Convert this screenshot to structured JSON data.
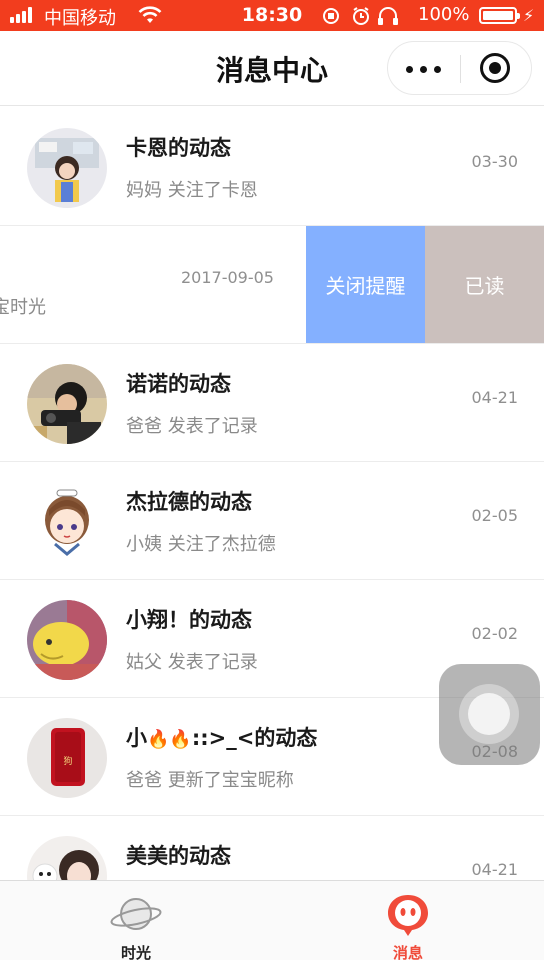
{
  "status_bar": {
    "carrier": "中国移动",
    "time": "18:30",
    "battery": "100%"
  },
  "header": {
    "title": "消息中心"
  },
  "messages": [
    {
      "title": "卡恩的动态",
      "subtitle": "妈妈 关注了卡恩",
      "date": "03-30"
    },
    {
      "title": "",
      "subtitle": "宝时光",
      "date": "2017-09-05",
      "swiped": true
    },
    {
      "title": "诺诺的动态",
      "subtitle": "爸爸 发表了记录",
      "date": "04-21"
    },
    {
      "title": "杰拉德的动态",
      "subtitle": "小姨 关注了杰拉德",
      "date": "02-05"
    },
    {
      "title": "小翔！的动态",
      "subtitle": "姑父 发表了记录",
      "date": "02-02"
    },
    {
      "title_prefix": "小",
      "title_emoji": "🔥🔥",
      "title_suffix": "::>_<的动态",
      "subtitle": "爸爸 更新了宝宝昵称",
      "date": "02-08"
    },
    {
      "title": "美美的动态",
      "subtitle": "",
      "date": "04-21"
    }
  ],
  "swipe_actions": {
    "mute_label": "关闭提醒",
    "read_label": "已读"
  },
  "tabs": [
    {
      "label": "时光",
      "icon": "planet-icon",
      "active": false
    },
    {
      "label": "消息",
      "icon": "message-face-icon",
      "active": true
    }
  ],
  "colors": {
    "status_bar": "#f23d1e",
    "mute_button": "#84b0ff",
    "read_button": "#cbc0bd",
    "active_tab": "#f04b3a"
  }
}
